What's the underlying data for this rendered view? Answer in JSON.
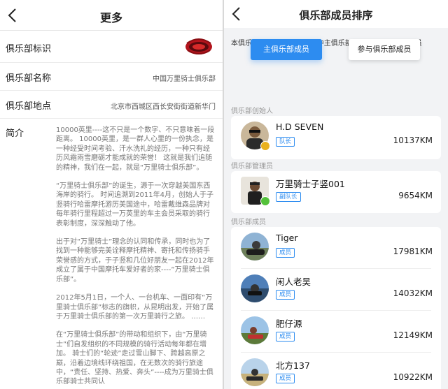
{
  "left": {
    "title": "更多",
    "rows": {
      "logo_label": "俱乐部标识",
      "name_label": "俱乐部名称",
      "name_value": "中国万里骑士俱乐部",
      "location_label": "俱乐部地点",
      "location_value": "北京市西城区西长安街街道新华门"
    },
    "intro_label": "简介",
    "intro_paragraphs": [
      "10000英里----这不只是一个数字、不只意味着一段距离。 10000英里，是一群人心里的一份执念，是一种经受时间考验、汗水洗礼的经历，一种只有经历风霜雨雪磨砺才能成就的荣誉！ 这就是我们追随的精神，我们在一起，就是“万里骑士俱乐部”。",
      "“万里骑士俱乐部”的诞生，源于一次穿越美国东西海岸的骑行。 时间追溯到2011年4月，创始人于子竖骑行哈雷摩托游历美国途中，哈雷戴维森品牌对每年骑行里程超过一万英里的车主会员采取的骑行表彰制度，深深触动了他。",
      "出于对“万里骑士”理念的认同和传承，同时也为了找到一种能够完美诠释摩托精神、寄托和传扬骑手荣誉感的方式，于子竖和几位好朋友一起在2012年成立了属于中国摩托车爱好者的家----“万里骑士俱乐部”。",
      "2012年5月1日，一个人、一台机车、一面印有“万里骑士俱乐部”标志的旗帜，从昆明出发，开始了属于万里骑士俱乐部的第一次万里骑行之旅。 ……",
      "在“万里骑士俱乐部”的带动和组织下，由“万里骑士”们自发组织的不同规模的骑行活动每年都在增加。 骑士们的“轮迹”走过雪山脚下、跨越高原之巅，沿着边境线环绕祖国，在无数次的骑行旅途中，“责任、坚持、热爱、奔头”----成为万里骑士俱乐部骑士共同认"
    ]
  },
  "right": {
    "title": "俱乐部成员排序",
    "summary": "本俱乐部共有79名成员，其中主俱乐部部成员为贡献数据成员",
    "tab_main": "主俱乐部成员",
    "tab_join": "参与俱乐部成员",
    "sections": {
      "founder": "俱乐部创始人",
      "admin": "俱乐部管理员",
      "members": "俱乐部成员"
    },
    "founder": {
      "name": "H.D SEVEN",
      "role": "队长",
      "distance": "10137KM"
    },
    "admin": {
      "name": "万里骑士子竖001",
      "role": "副队长",
      "distance": "9654KM"
    },
    "members": [
      {
        "name": "Tiger",
        "role": "成员",
        "distance": "17981KM"
      },
      {
        "name": "闲人老吴",
        "role": "成员",
        "distance": "14032KM"
      },
      {
        "name": "肥仔源",
        "role": "成员",
        "distance": "12149KM"
      },
      {
        "name": "北方137",
        "role": "成员",
        "distance": "10922KM"
      }
    ]
  },
  "colors": {
    "accent": "#2d8cf0",
    "badge_gold": "#e9b11f",
    "badge_green": "#54c13a"
  },
  "icons": {
    "back": "chevron-left-icon",
    "logo": "club-logo",
    "crown": "crown-badge-icon"
  }
}
